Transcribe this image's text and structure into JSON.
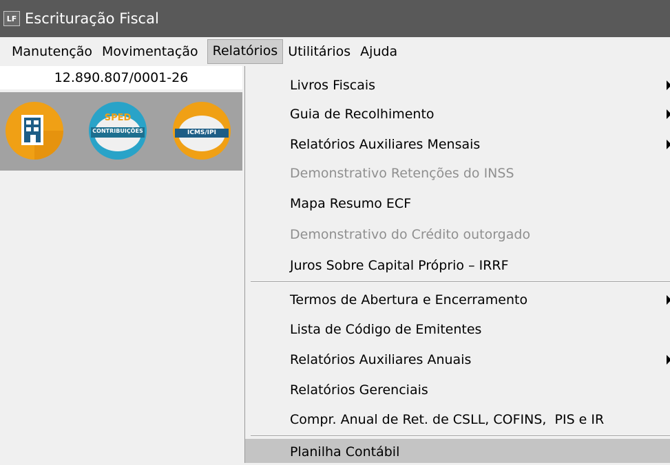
{
  "window": {
    "title": "Escrituração Fiscal",
    "icon_text": "LF"
  },
  "menubar": {
    "items": [
      {
        "label": "Manutenção"
      },
      {
        "label": "Movimentação"
      },
      {
        "label": "Relatórios",
        "active": true
      },
      {
        "label": "Utilitários"
      },
      {
        "label": "Ajuda"
      }
    ]
  },
  "company": {
    "cnpj": "12.890.807/0001-26"
  },
  "shortcuts": {
    "sped_line1": "SPED",
    "sped_line2": "CONTRIBUIÇÕES",
    "icms_label": "ICMS/IPI"
  },
  "dropdown": {
    "items": [
      {
        "label": "Livros Fiscais",
        "submenu": true
      },
      {
        "label": "Guia de Recolhimento",
        "submenu": true
      },
      {
        "label": "Relatórios Auxiliares Mensais",
        "submenu": true
      },
      {
        "label": "Demonstrativo Retenções do INSS",
        "disabled": true
      },
      {
        "label": "Mapa Resumo ECF"
      },
      {
        "label": "Demonstrativo do Crédito outorgado",
        "disabled": true
      },
      {
        "label": "Juros Sobre Capital Próprio – IRRF"
      },
      {
        "label": "Termos de Abertura e Encerramento",
        "submenu": true
      },
      {
        "label": "Lista de Código de Emitentes"
      },
      {
        "label": "Relatórios Auxiliares Anuais",
        "submenu": true
      },
      {
        "label": "Relatórios Gerenciais"
      },
      {
        "label": "Compr. Anual de Ret. de CSLL, COFINS,  PIS e IR"
      },
      {
        "label": "Planilha Contábil",
        "highlighted": true
      }
    ]
  },
  "colors": {
    "titlebar": "#595959",
    "icon_strip": "#a2a2a2",
    "orange": "#f0a015",
    "sped_blue": "#29a3c8",
    "disabled_text": "#8f8f8f"
  }
}
